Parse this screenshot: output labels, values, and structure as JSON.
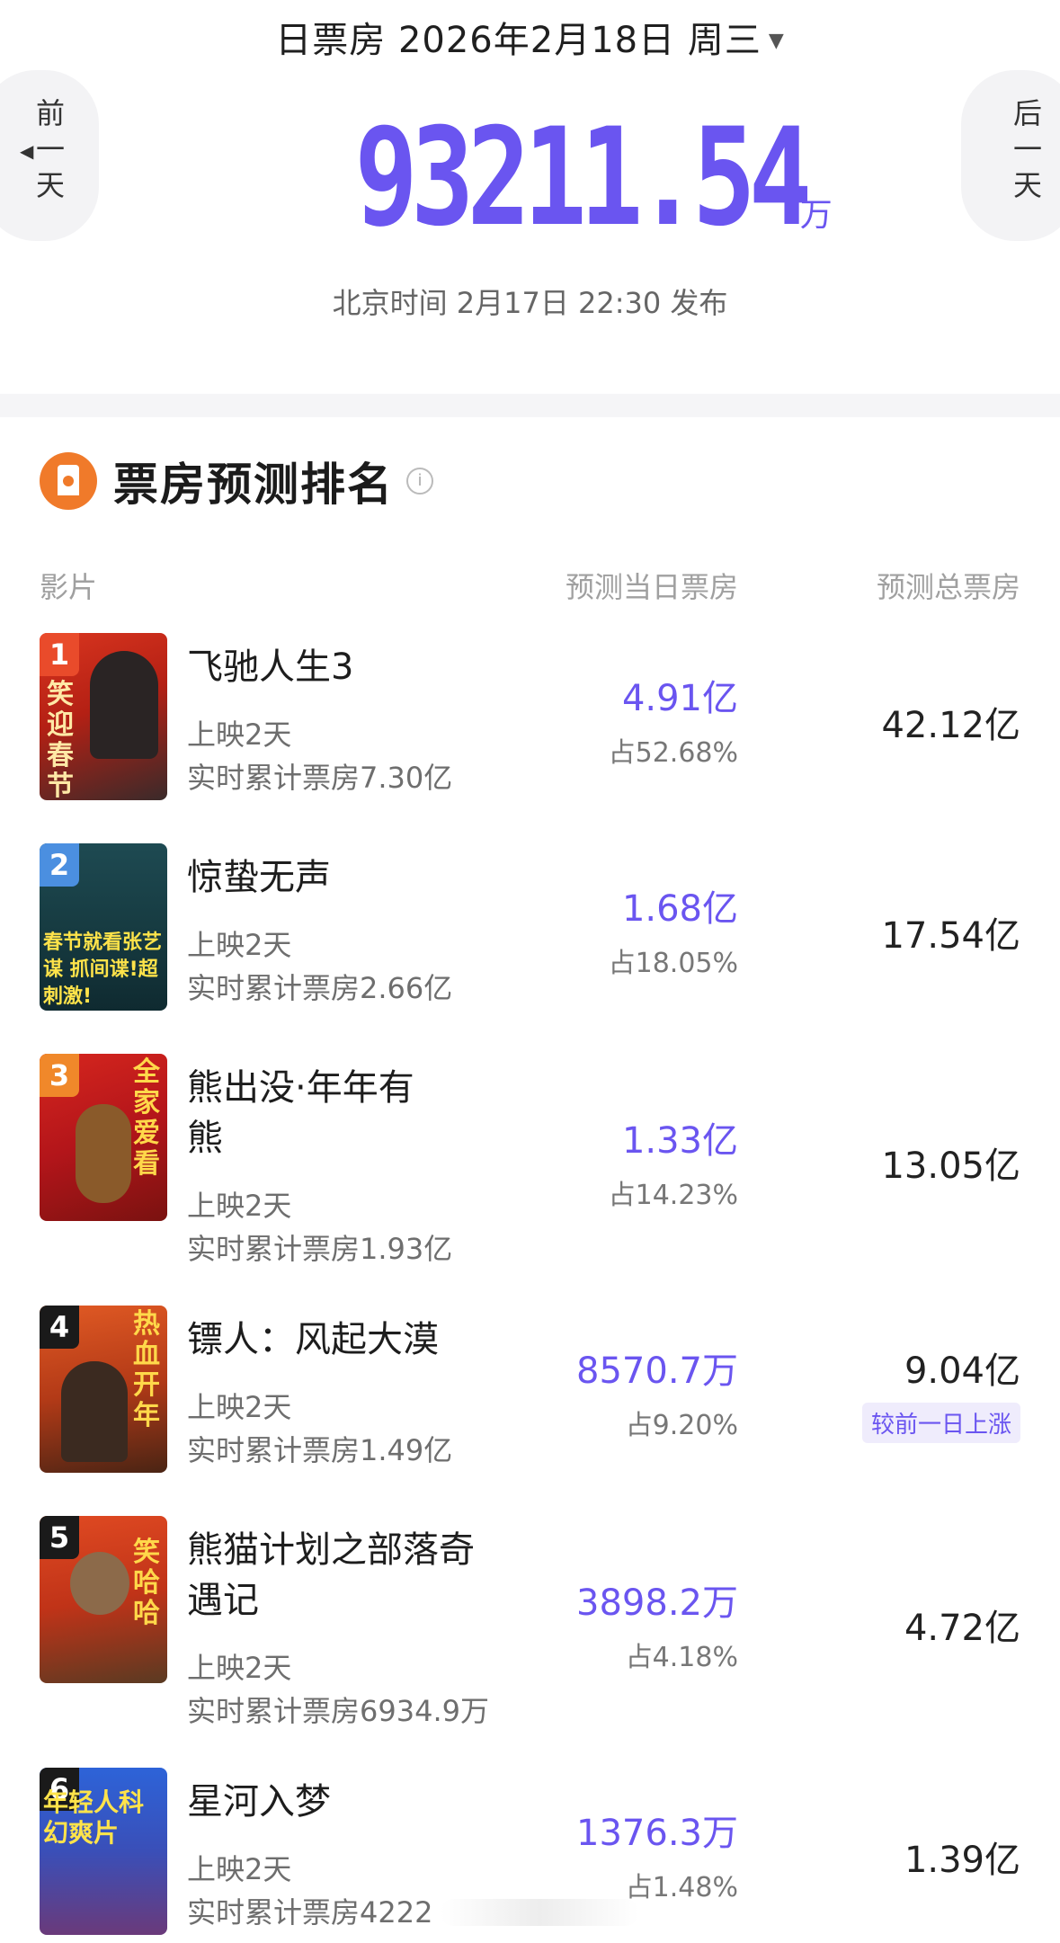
{
  "header": {
    "date_title": "日票房 2026年2月18日 周三",
    "caret": "▼",
    "prev_label": "前\n一\n天",
    "next_label": "后\n一\n天",
    "prev_arrow": "◀",
    "next_arrow": "▶",
    "total_value": "93211.54",
    "total_unit": "万",
    "publish_time": "北京时间 2月17日 22:30 发布"
  },
  "section": {
    "title": "票房预测排名",
    "info_glyph": "i",
    "col_film": "影片",
    "col_pred_day": "预测当日票房",
    "col_pred_total": "预测总票房"
  },
  "colors": {
    "accent": "#6a55f0",
    "rank_colors": [
      "#e94b2b",
      "#4b8fe0",
      "#f0882a",
      "#1a1a1a",
      "#1a1a1a",
      "#1a1a1a"
    ]
  },
  "movies": [
    {
      "rank": "1",
      "name_l1": "飞驰人生3",
      "name_l2": "",
      "days": "上映2天",
      "cumulative": "实时累计票房7.30亿",
      "pred_day": "4.91亿",
      "share": "占52.68%",
      "pred_total": "42.12亿",
      "badge": "",
      "poster_text": "笑迎春节"
    },
    {
      "rank": "2",
      "name_l1": "惊蛰无声",
      "name_l2": "",
      "days": "上映2天",
      "cumulative": "实时累计票房2.66亿",
      "pred_day": "1.68亿",
      "share": "占18.05%",
      "pred_total": "17.54亿",
      "badge": "",
      "poster_text": "春节就看张艺谋 抓间谍!超刺激!"
    },
    {
      "rank": "3",
      "name_l1": "熊出没·年年有",
      "name_l2": "熊",
      "days": "上映2天",
      "cumulative": "实时累计票房1.93亿",
      "pred_day": "1.33亿",
      "share": "占14.23%",
      "pred_total": "13.05亿",
      "badge": "",
      "poster_text": "全家爱看"
    },
    {
      "rank": "4",
      "name_l1": "镖人：风起大漠",
      "name_l2": "",
      "days": "上映2天",
      "cumulative": "实时累计票房1.49亿",
      "pred_day": "8570.7万",
      "share": "占9.20%",
      "pred_total": "9.04亿",
      "badge": "较前一日上涨",
      "poster_text": "热血开年"
    },
    {
      "rank": "5",
      "name_l1": "熊猫计划之部落奇",
      "name_l2": "遇记",
      "days": "上映2天",
      "cumulative": "实时累计票房6934.9万",
      "pred_day": "3898.2万",
      "share": "占4.18%",
      "pred_total": "4.72亿",
      "badge": "",
      "poster_text": "笑哈哈"
    },
    {
      "rank": "6",
      "name_l1": "星河入梦",
      "name_l2": "",
      "days": "上映2天",
      "cumulative": "实时累计票房4222",
      "pred_day": "1376.3万",
      "share": "占1.48%",
      "pred_total": "1.39亿",
      "badge": "",
      "poster_text": "年轻人科幻爽片"
    }
  ]
}
